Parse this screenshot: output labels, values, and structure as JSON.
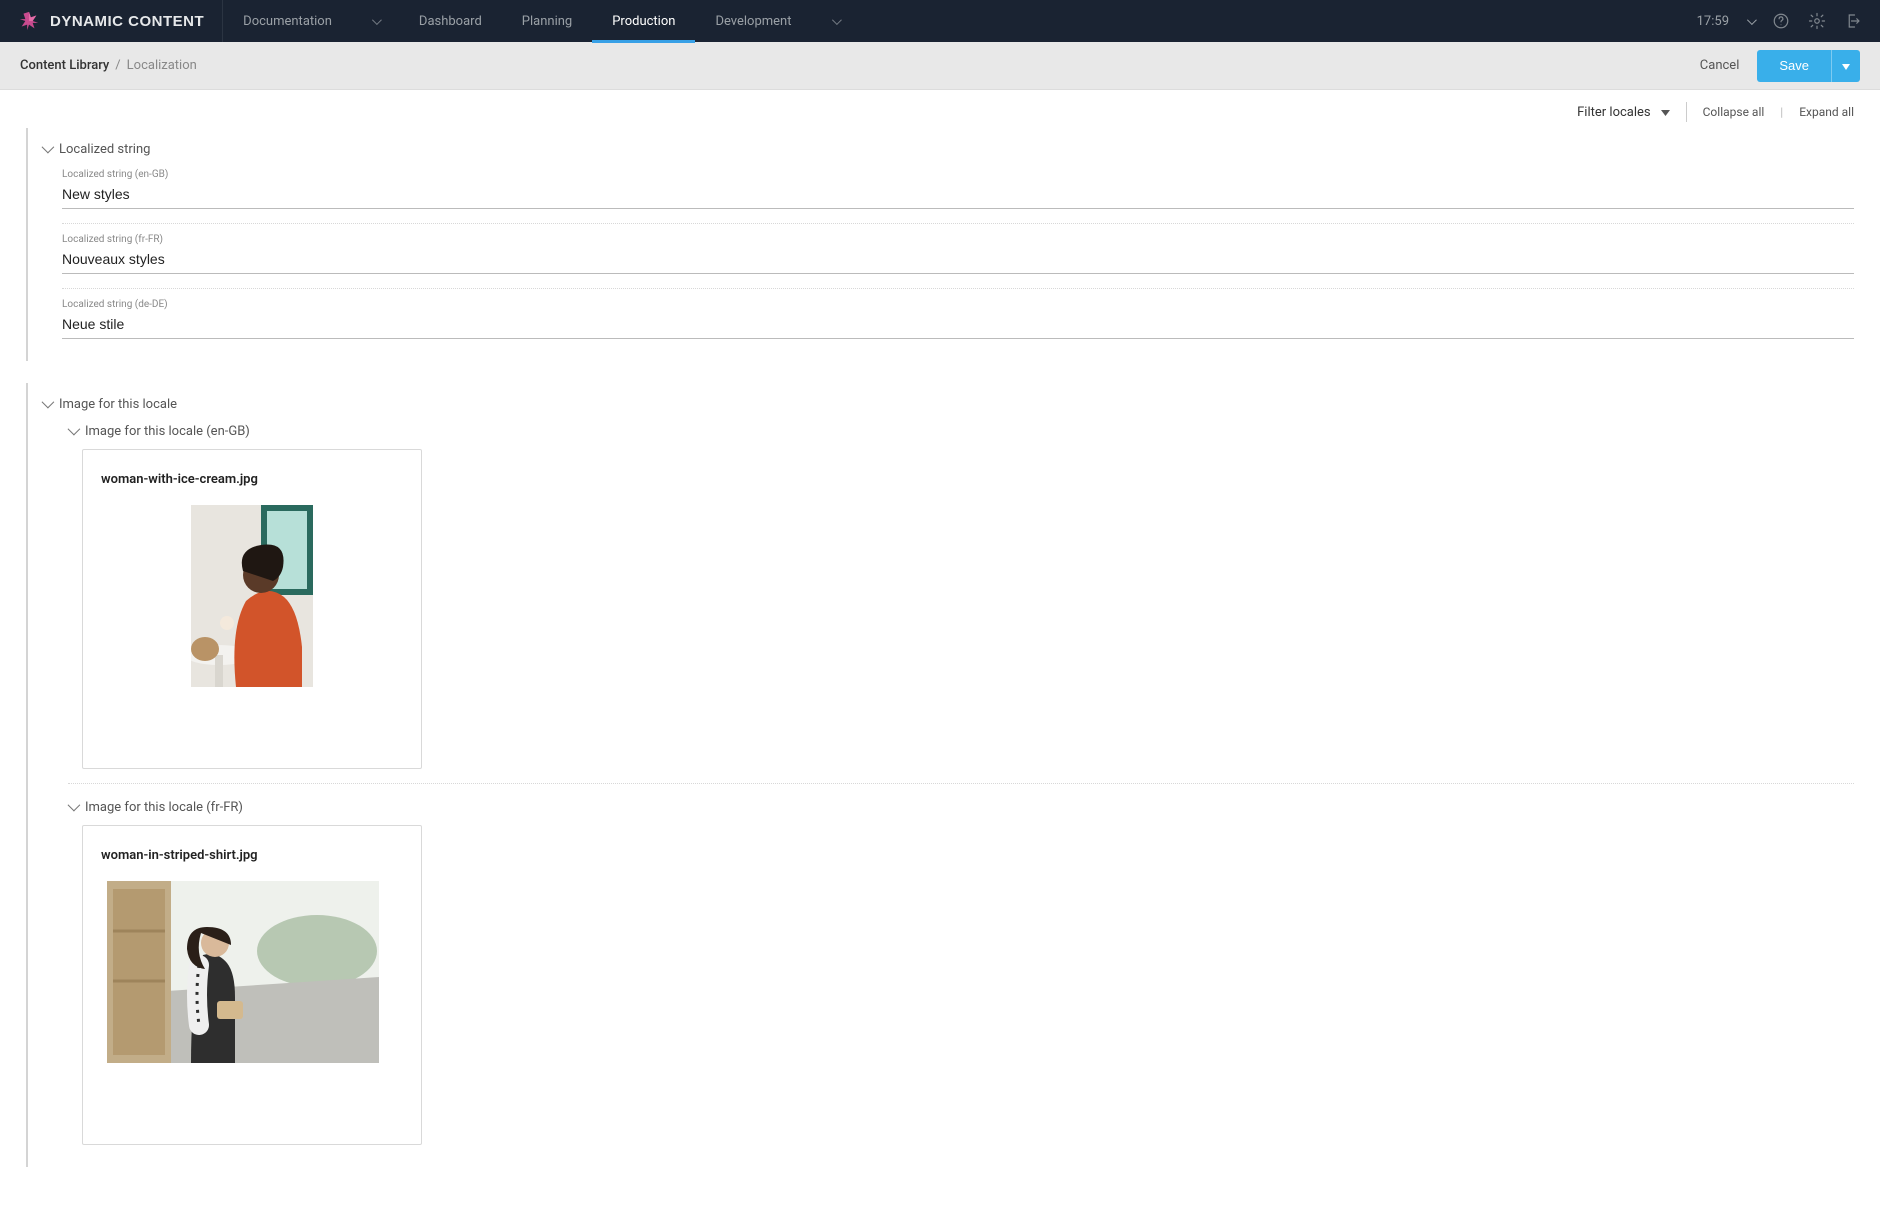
{
  "brand": "DYNAMIC CONTENT",
  "topnav": {
    "documentation": "Documentation",
    "dashboard": "Dashboard",
    "planning": "Planning",
    "production": "Production",
    "development": "Development"
  },
  "time": "17:59",
  "breadcrumb": {
    "root": "Content Library",
    "leaf": "Localization"
  },
  "actions": {
    "cancel": "Cancel",
    "save": "Save"
  },
  "toolbar": {
    "filter_locales": "Filter locales",
    "collapse_all": "Collapse all",
    "expand_all": "Expand all"
  },
  "localized_string": {
    "section_title": "Localized string",
    "fields": [
      {
        "label": "Localized string (en-GB)",
        "value": "New styles"
      },
      {
        "label": "Localized string (fr-FR)",
        "value": "Nouveaux styles"
      },
      {
        "label": "Localized string (de-DE)",
        "value": "Neue stile"
      }
    ]
  },
  "image_section": {
    "section_title": "Image for this locale",
    "locales": [
      {
        "heading": "Image for this locale (en-GB)",
        "filename": "woman-with-ice-cream.jpg"
      },
      {
        "heading": "Image for this locale (fr-FR)",
        "filename": "woman-in-striped-shirt.jpg"
      }
    ]
  }
}
